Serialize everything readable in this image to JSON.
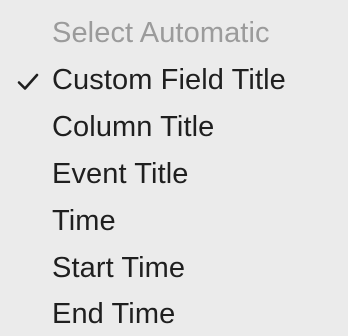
{
  "menu": {
    "items": [
      {
        "label": "Select Automatic",
        "enabled": false,
        "checked": false
      },
      {
        "label": "Custom Field Title",
        "enabled": true,
        "checked": true
      },
      {
        "label": "Column Title",
        "enabled": true,
        "checked": false
      },
      {
        "label": "Event Title",
        "enabled": true,
        "checked": false
      },
      {
        "label": "Time",
        "enabled": true,
        "checked": false
      },
      {
        "label": "Start Time",
        "enabled": true,
        "checked": false
      },
      {
        "label": "End Time",
        "enabled": true,
        "checked": false
      }
    ],
    "check_icon": "checkmark-icon"
  },
  "colors": {
    "background": "#ebebeb",
    "text": "#1f1f1f",
    "disabled_text": "#9b9b9b"
  }
}
